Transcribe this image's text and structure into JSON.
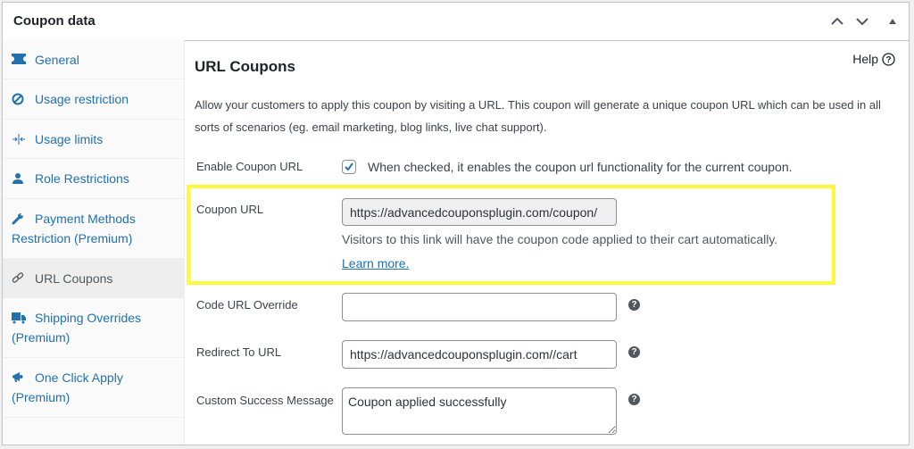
{
  "panel": {
    "title": "Coupon data",
    "controls": [
      "move-up",
      "move-down",
      "toggle-panel"
    ]
  },
  "sidebar": {
    "items": [
      {
        "label": "General",
        "icon": "ticket-icon",
        "active": false
      },
      {
        "label": "Usage restriction",
        "icon": "block-icon",
        "active": false
      },
      {
        "label": "Usage limits",
        "icon": "limits-icon",
        "active": false
      },
      {
        "label": "Role Restrictions",
        "icon": "user-icon",
        "active": false
      },
      {
        "label": "Payment Methods Restriction (Premium)",
        "icon": "wrench-icon",
        "active": false
      },
      {
        "label": "URL Coupons",
        "icon": "link-icon",
        "active": true
      },
      {
        "label": "Shipping Overrides (Premium)",
        "icon": "truck-icon",
        "active": false
      },
      {
        "label": "One Click Apply (Premium)",
        "icon": "megaphone-icon",
        "active": false
      }
    ]
  },
  "content": {
    "title": "URL Coupons",
    "help_label": "Help",
    "intro": "Allow your customers to apply this coupon by visiting a URL. This coupon will generate a unique coupon URL which can be used in all sorts of scenarios (eg. email marketing, blog links, live chat support).",
    "enable": {
      "label": "Enable Coupon URL",
      "checked": true,
      "description": "When checked, it enables the coupon url functionality for the current coupon."
    },
    "coupon_url": {
      "label": "Coupon URL",
      "value": "https://advancedcouponsplugin.com/coupon/",
      "description": "Visitors to this link will have the coupon code applied to their cart automatically.",
      "learn_more": "Learn more."
    },
    "code_override": {
      "label": "Code URL Override",
      "value": ""
    },
    "redirect": {
      "label": "Redirect To URL",
      "value": "https://advancedcouponsplugin.com//cart"
    },
    "success_message": {
      "label": "Custom Success Message",
      "value": "Coupon applied successfully"
    },
    "tooltip_glyph": "?"
  },
  "colors": {
    "link": "#2271b1",
    "highlight": "#fff93a",
    "active_item_bg": "#eeeeee"
  }
}
